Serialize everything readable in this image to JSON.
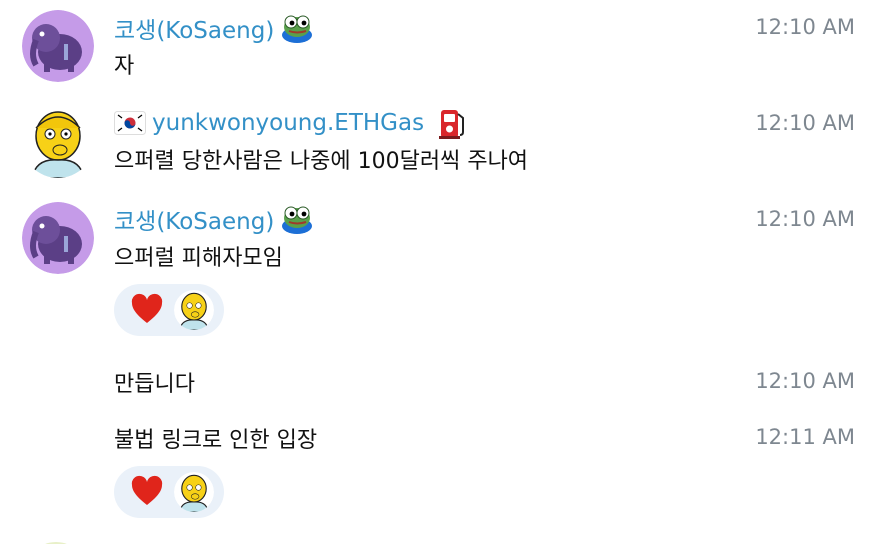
{
  "messages": [
    {
      "sender": "코생(KoSaeng)",
      "sender_badge": "pepe-frog-icon",
      "text": "자",
      "time": "12:10 AM"
    },
    {
      "sender": "yunkwonyoung.ETHGas",
      "sender_flag": "korea-flag-icon",
      "sender_badge": "gas-pump-icon",
      "text": "으퍼렬 당한사람은 나중에 100달러씩 주나여",
      "time": "12:10 AM"
    },
    {
      "sender": "코생(KoSaeng)",
      "sender_badge": "pepe-frog-icon",
      "text": "으퍼럴 피해자모임",
      "time": "12:10 AM",
      "reaction": "heart-icon"
    },
    {
      "text": "만듭니다",
      "time": "12:10 AM"
    },
    {
      "text": "불법 링크로 인한 입장",
      "time": "12:11 AM",
      "reaction": "heart-icon"
    }
  ],
  "colors": {
    "sender_name": "#3390c7",
    "timestamp": "#7e8790",
    "reaction_bg": "#eaf1f9",
    "heart": "#e0251b"
  }
}
